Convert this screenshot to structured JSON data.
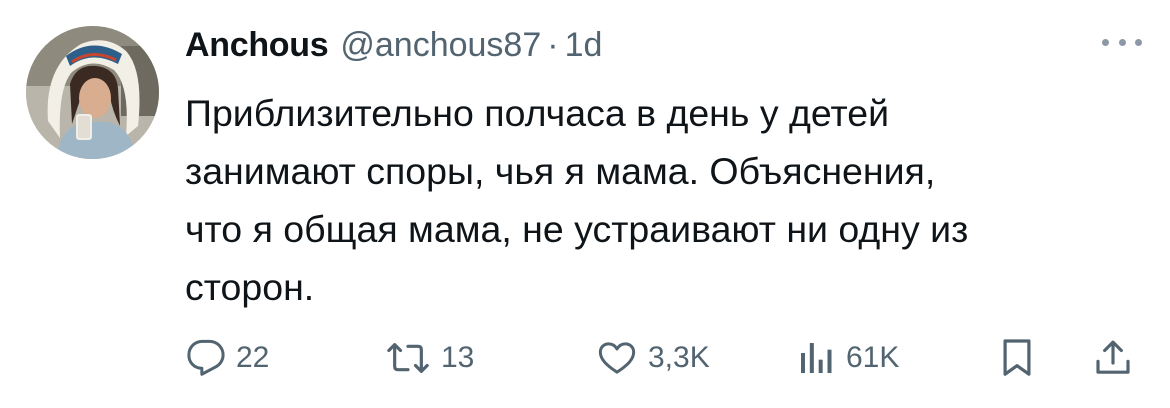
{
  "tweet": {
    "author": {
      "name": "Anchous",
      "handle": "@anchous87",
      "separator": "·",
      "time": "1d"
    },
    "text_lines": [
      "Приблизительно полчаса в день у детей",
      "занимают споры, чья я мама. Объяснения,",
      "что я общая мама, не устраивают ни одну из",
      "сторон."
    ],
    "actions": {
      "replies": "22",
      "reposts": "13",
      "likes": "3,3K",
      "views": "61K"
    },
    "icons": {
      "more": "more-horizontal-icon",
      "reply": "reply-bubble-icon",
      "repost": "repost-arrows-icon",
      "like": "heart-icon",
      "views": "views-bar-chart-icon",
      "bookmark": "bookmark-icon",
      "share": "share-upload-icon"
    },
    "colors": {
      "text_primary": "#0f1419",
      "text_secondary": "#536471",
      "background": "#ffffff"
    }
  }
}
